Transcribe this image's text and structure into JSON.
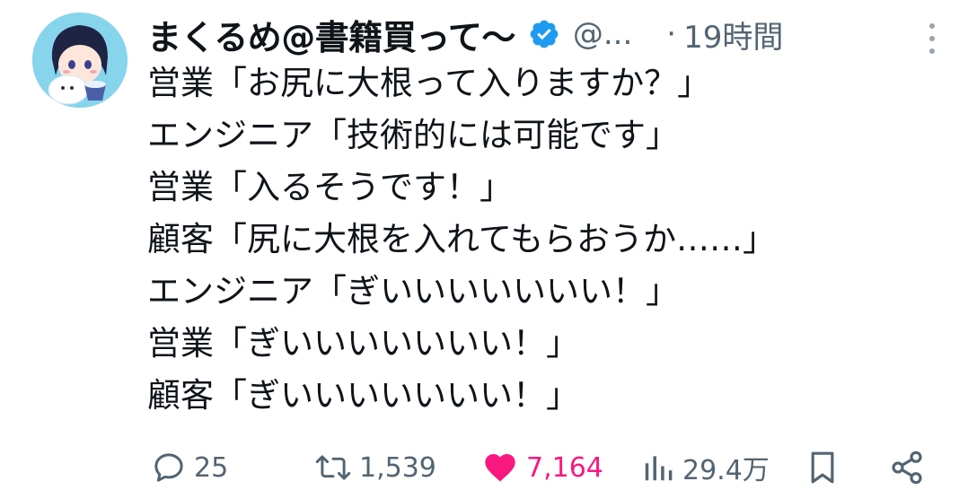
{
  "post": {
    "display_name": "まくるめ@書籍買って〜",
    "handle": "@...",
    "separator": "·",
    "time": "19時間",
    "lines": [
      "営業「お尻に大根って入りますか？」",
      "エンジニア「技術的には可能です」",
      "営業「入るそうです！」",
      "顧客「尻に大根を入れてもらおうか……」",
      "エンジニア「ぎいいいいいいい！」",
      "営業「ぎいいいいいいい！」",
      "顧客「ぎいいいいいいい！」"
    ],
    "metrics": {
      "replies": "25",
      "retweets": "1,539",
      "likes": "7,164",
      "views": "29.4万"
    }
  },
  "icons": {
    "verified": "verified-badge-icon",
    "more": "more-vertical-icon",
    "reply": "reply-icon",
    "retweet": "retweet-icon",
    "like": "heart-icon",
    "views": "views-bar-icon",
    "bookmark": "bookmark-icon",
    "share": "share-icon"
  },
  "colors": {
    "text": "#0f1419",
    "secondary": "#536471",
    "verified": "#1d9bf0",
    "like": "#f91880",
    "avatar_bg": "#7fd3ea"
  }
}
